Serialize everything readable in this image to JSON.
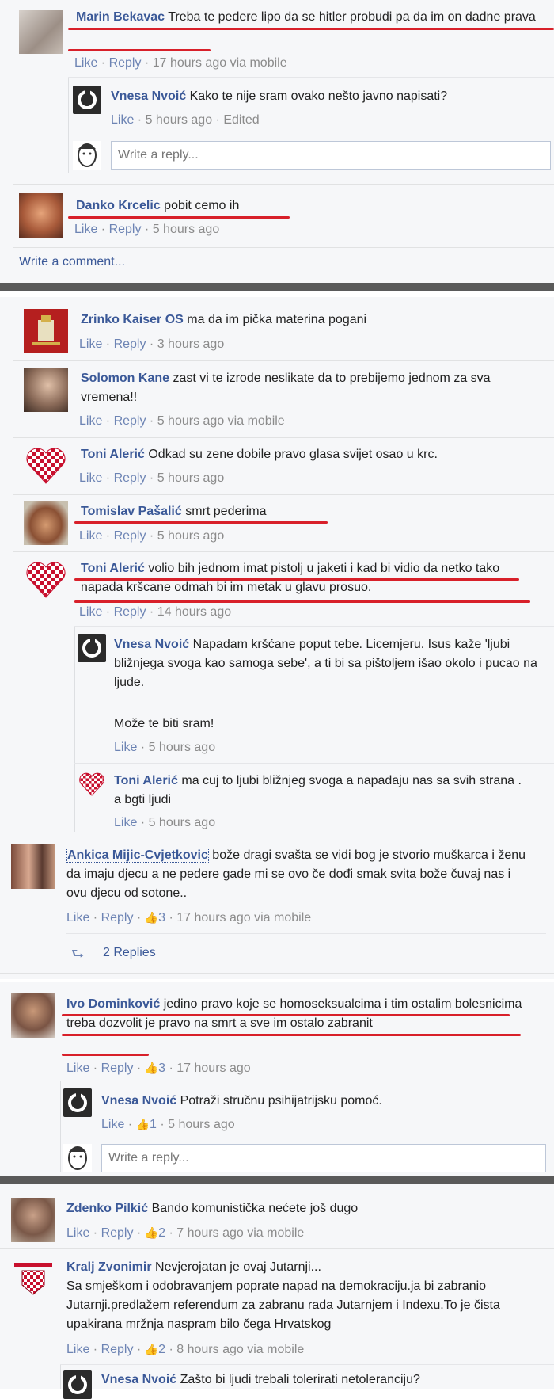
{
  "common": {
    "like": "Like",
    "reply": "Reply",
    "dot": " · ",
    "via_mobile": "via mobile",
    "edited": "Edited",
    "write_reply": "Write a reply...",
    "write_comment": "Write a comment..."
  },
  "c1": {
    "name": "Marin Bekavac",
    "text": "Treba te pedere lipo da se hitler probudi pa da im on dadne prava",
    "time": "17 hours ago"
  },
  "c1r1": {
    "name": "Vnesa Nvoić",
    "text": "Kako te nije sram ovako nešto javno napisati?",
    "time": "5 hours ago"
  },
  "c2": {
    "name": "Danko Krcelic",
    "text": "pobit cemo ih",
    "time": "5 hours ago"
  },
  "c3": {
    "name": "Zrinko Kaiser OS",
    "text": "ma da im pička materina pogani",
    "time": "3 hours ago"
  },
  "c4": {
    "name": "Solomon Kane",
    "text": "zast vi te izrode neslikate da to prebijemo jednom za sva vremena!!",
    "time": "5 hours ago"
  },
  "c5": {
    "name": "Toni Alerić",
    "text": "Odkad su zene dobile pravo glasa svijet osao u krc.",
    "time": "5 hours ago"
  },
  "c6": {
    "name": "Tomislav Pašalić",
    "text": "smrt pederima",
    "time": "5 hours ago"
  },
  "c7": {
    "name": "Toni Alerić",
    "text": "volio bih jednom imat pistolj u jaketi i kad bi vidio da netko tako napada kršcane odmah bi im metak u glavu prosuo.",
    "time": "14 hours ago"
  },
  "c7r1": {
    "name": "Vnesa Nvoić",
    "text": "Napadam kršćane poput tebe. Licemjeru. Isus kaže 'ljubi bližnjega svoga kao samoga sebe', a ti bi sa pištoljem išao okolo i pucao na ljude.",
    "text2": "Može te biti sram!",
    "time": "5 hours ago"
  },
  "c7r2": {
    "name": "Toni Alerić",
    "text": "ma cuj to ljubi bližnjeg svoga a napadaju nas sa svih strana . a bgti ljudi",
    "time": "5 hours ago"
  },
  "c8": {
    "name": "Ankica Mijic-Cvjetkovic",
    "text": "bože dragi svašta se vidi bog je stvorio muškarca i ženu da imaju djecu a ne pedere gade mi se ovo če dođi smak svita bože čuvaj nas i ovu djecu od sotone..",
    "likes": "3",
    "time": "17 hours ago",
    "replies": "2 Replies"
  },
  "c9": {
    "name": "Ivo Dominković",
    "text": "jedino pravo koje se homoseksualcima i tim ostalim bolesnicima treba dozvolit je pravo na smrt a sve im ostalo zabranit",
    "likes": "3",
    "time": "17 hours ago"
  },
  "c9r1": {
    "name": "Vnesa Nvoić",
    "text": "Potraži stručnu psihijatrijsku pomoć.",
    "likes": "1",
    "time": "5 hours ago"
  },
  "c10": {
    "name": "Zdenko Pilkić",
    "text": "Bando komunistička nećete još dugo",
    "likes": "2",
    "time": "7 hours ago"
  },
  "c11": {
    "name": "Kralj Zvonimir",
    "line1": "Nevjerojatan je ovaj Jutarnji...",
    "line2": "Sa smješkom i odobravanjem poprate napad na demokraciju.ja bi zabranio Jutarnji.predlažem referendum za zabranu rada Jutarnjem i Indexu.To je čista upakirana mržnja naspram bilo čega Hrvatskog",
    "likes": "2",
    "time": "8 hours ago"
  },
  "c11r1": {
    "name": "Vnesa Nvoić",
    "text": "Zašto bi ljudi trebali tolerirati netoleranciju?"
  },
  "colors": {
    "link": "#3b5998",
    "meta": "#6d84b4",
    "underline": "#d8202a",
    "panel": "#f6f7f9"
  }
}
